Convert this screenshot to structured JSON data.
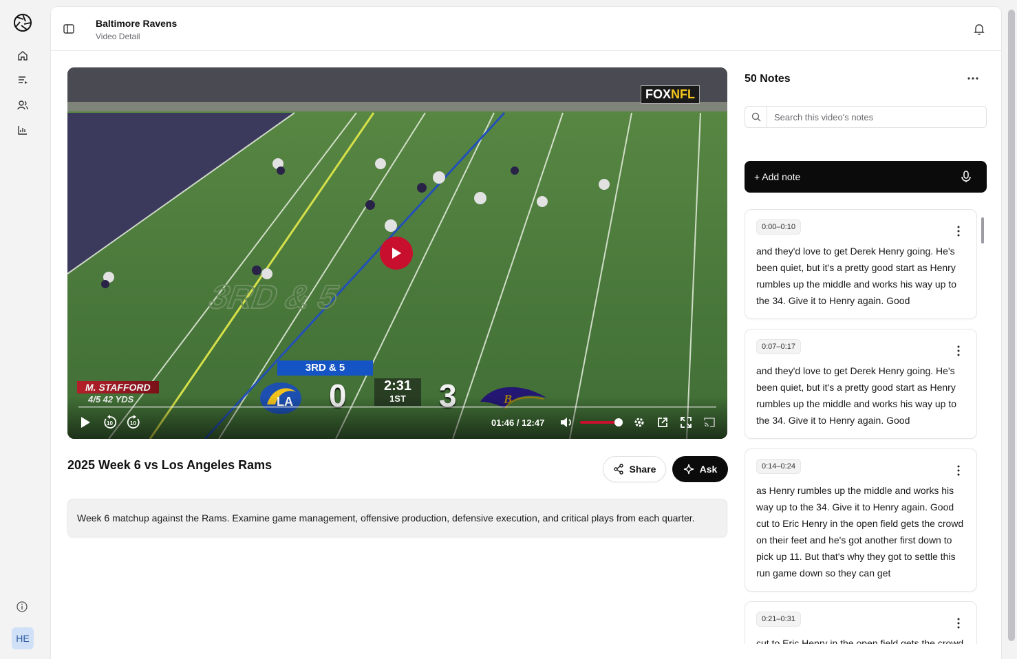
{
  "app": {
    "logo_icon": "aperture-icon",
    "nav": [
      {
        "name": "home",
        "icon": "home-icon"
      },
      {
        "name": "playlists",
        "icon": "list-icon"
      },
      {
        "name": "team",
        "icon": "users-icon"
      },
      {
        "name": "analytics",
        "icon": "bar-chart-icon"
      }
    ],
    "info_icon": "info-icon",
    "avatar_initials": "HE"
  },
  "header": {
    "title": "Baltimore Ravens",
    "subtitle": "Video Detail"
  },
  "video": {
    "network_fox": "FOX",
    "network_nfl": "NFL",
    "down_and_distance": "3RD & 5",
    "away_score": "0",
    "home_score": "3",
    "game_clock": "2:31",
    "quarter": "1ST",
    "qb_name": "M. STAFFORD",
    "qb_line": "4/5  42 YDS",
    "current_time": "01:46",
    "duration": "12:47",
    "volume": 0.9,
    "progress": 0.14
  },
  "video_title": "2025 Week 6 vs Los Angeles Rams",
  "actions": {
    "share_label": "Share",
    "ask_label": "Ask"
  },
  "description": "Week 6 matchup against the Rams. Examine game management, offensive production, defensive execution, and critical plays from each quarter.",
  "notes": {
    "count_label": "50 Notes",
    "search_placeholder": "Search this video's notes",
    "add_label": "+ Add note",
    "items": [
      {
        "stamp": "0:00–0:10",
        "text": "and they'd love to get Derek Henry going. He's been quiet, but it's a pretty good start as Henry rumbles up the middle and works his way up to the 34. Give it to Henry again. Good"
      },
      {
        "stamp": "0:07–0:17",
        "text": "and they'd love to get Derek Henry going. He's been quiet, but it's a pretty good start as Henry rumbles up the middle and works his way up to the 34. Give it to Henry again. Good"
      },
      {
        "stamp": "0:14–0:24",
        "text": "as Henry rumbles up the middle and works his way up to the 34. Give it to Henry again. Good cut to Eric Henry in the open field gets the crowd on their feet and he's got another first down to pick up 11. But that's why they got to settle this run game down so they can get"
      },
      {
        "stamp": "0:21–0:31",
        "text": "cut to Eric Henry in the open field gets the crowd"
      }
    ]
  }
}
